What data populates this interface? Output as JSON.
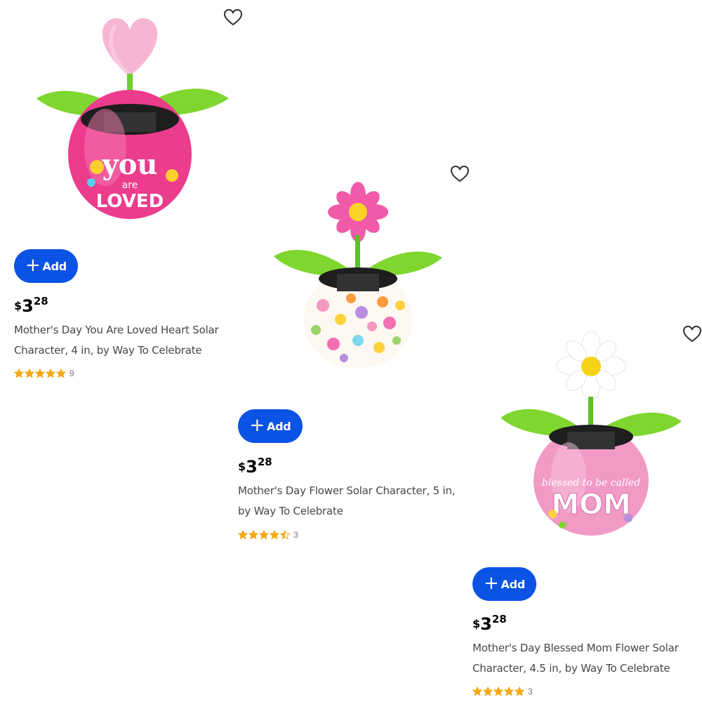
{
  "products": [
    {
      "add_label": "Add",
      "price_currency": "$",
      "price_dollars": "3",
      "price_cents": "28",
      "title_line1": "Mother's Day You Are Loved Heart Solar",
      "title_line2": "Character, 4 in, by Way To Celebrate",
      "rating_value": 5,
      "review_count": "9",
      "pot_text_1": "you",
      "pot_text_2": "are",
      "pot_text_3": "LOVED"
    },
    {
      "add_label": "Add",
      "price_currency": "$",
      "price_dollars": "3",
      "price_cents": "28",
      "title_line1": "Mother's Day Flower Solar Character, 5 in,",
      "title_line2": "by Way To Celebrate",
      "rating_value": 4.5,
      "review_count": "3"
    },
    {
      "add_label": "Add",
      "price_currency": "$",
      "price_dollars": "3",
      "price_cents": "28",
      "title_line1": "Mother's Day Blessed Mom Flower Solar",
      "title_line2": "Character, 4.5 in, by Way To Celebrate",
      "rating_value": 5,
      "review_count": "3",
      "pot_text_1": "blessed to be called",
      "pot_text_2": "MOM"
    }
  ],
  "colors": {
    "add_button": "#0a53e4",
    "star": "#f3a816",
    "leaf": "#74d32a",
    "pink_pot": "#ee3f8f",
    "light_pink_pot": "#f29ac9"
  },
  "icons": [
    "heart-outline-icon",
    "plus-icon",
    "star-icon"
  ]
}
